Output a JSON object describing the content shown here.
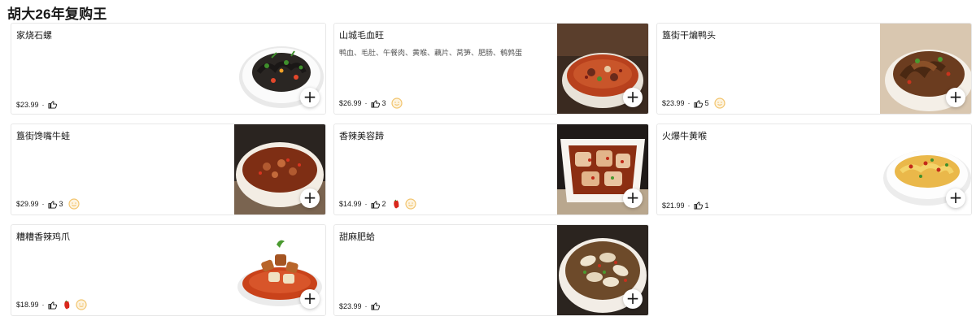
{
  "section": {
    "title": "胡大26年复购王"
  },
  "items": [
    {
      "name": "家烧石螺",
      "description": "",
      "price": "$23.99",
      "likes": "",
      "spicy": false,
      "badge": false,
      "image": "white-plate-squid",
      "bg": "white"
    },
    {
      "name": "山城毛血旺",
      "description": "鸭血、毛肚、午餐肉、黄喉、藕片、莴笋、肥肠、鹌鹑蛋",
      "price": "$26.99",
      "likes": "3",
      "spicy": false,
      "badge": true,
      "image": "red-broth-bowl",
      "bg": "dark"
    },
    {
      "name": "簋街干煸鸭头",
      "description": "",
      "price": "$23.99",
      "likes": "5",
      "spicy": false,
      "badge": true,
      "image": "duck-head-bowl",
      "bg": "light"
    },
    {
      "name": "簋街馋嘴牛蛙",
      "description": "",
      "price": "$29.99",
      "likes": "3",
      "spicy": false,
      "badge": true,
      "image": "bullfrog-bowl",
      "bg": "dark"
    },
    {
      "name": "香辣美容蹄",
      "description": "",
      "price": "$14.99",
      "likes": "2",
      "spicy": true,
      "badge": true,
      "image": "square-pig-trotter",
      "bg": "dark"
    },
    {
      "name": "火爆牛黄喉",
      "description": "",
      "price": "$21.99",
      "likes": "1",
      "spicy": false,
      "badge": false,
      "image": "yellow-stirfry-plate",
      "bg": "white"
    },
    {
      "name": "糟糟香辣鸡爪",
      "description": "",
      "price": "$18.99",
      "likes": "",
      "spicy": true,
      "badge": true,
      "image": "chicken-feet-bowl",
      "bg": "white"
    },
    {
      "name": "甜麻肥蛤",
      "description": "",
      "price": "$23.99",
      "likes": "",
      "spicy": false,
      "badge": false,
      "image": "clam-bowl",
      "bg": "dark"
    }
  ],
  "icons": {
    "like": "thumbs-up-icon",
    "add": "plus-icon",
    "spicy": "chili-icon",
    "badge": "smiley-badge-icon"
  },
  "colors": {
    "badge": "#f2c46d",
    "chili": "#d9281c",
    "border": "#e7e7e7"
  },
  "labels": {
    "add": "+",
    "separator": "·"
  }
}
